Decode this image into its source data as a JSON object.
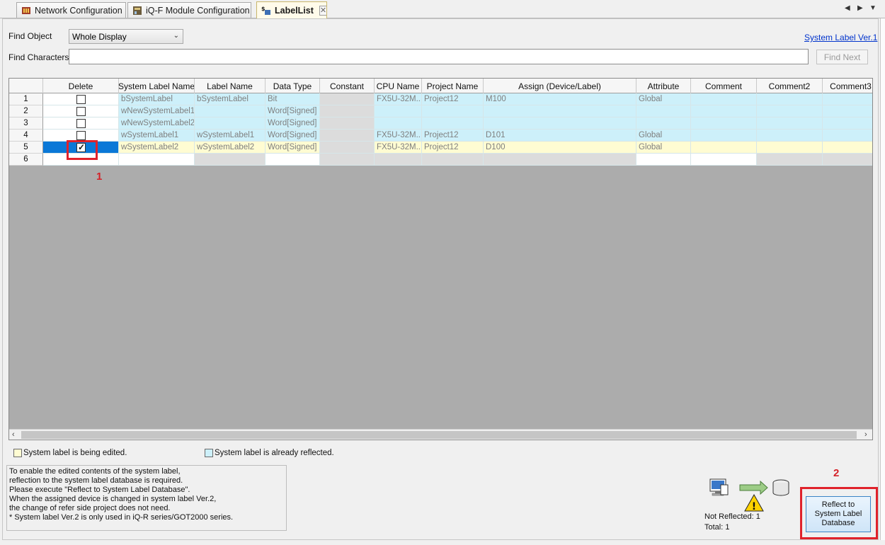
{
  "tabs": [
    {
      "label": "Network Configuration",
      "icon": "network-icon"
    },
    {
      "label": "iQ-F Module Configuration",
      "icon": "module-config-icon"
    },
    {
      "label": "LabelList",
      "icon": "label-list-icon",
      "active": true
    }
  ],
  "find": {
    "object_label": "Find Object",
    "object_value": "Whole Display",
    "characters_label": "Find Characters",
    "characters_value": "",
    "find_next": "Find Next",
    "system_label_link": "System Label Ver.1"
  },
  "table": {
    "columns": [
      "Delete",
      "System Label Name",
      "Label Name",
      "Data Type",
      "Constant",
      "CPU Name",
      "Project Name",
      "Assign (Device/Label)",
      "Attribute",
      "Comment",
      "Comment2",
      "Comment3"
    ],
    "rows": [
      {
        "num": "1",
        "delete": false,
        "system_label_name": "bSystemLabel",
        "label_name": "bSystemLabel",
        "data_type": "Bit",
        "constant": "",
        "cpu_name": "FX5U-32M...",
        "project_name": "Project12",
        "assign": "M100",
        "attribute": "Global",
        "comment": "",
        "comment2": "",
        "comment3": ""
      },
      {
        "num": "2",
        "delete": false,
        "system_label_name": "wNewSystemLabel1",
        "label_name": "",
        "data_type": "Word[Signed]",
        "constant": "",
        "cpu_name": "",
        "project_name": "",
        "assign": "",
        "attribute": "",
        "comment": "",
        "comment2": "",
        "comment3": ""
      },
      {
        "num": "3",
        "delete": false,
        "system_label_name": "wNewSystemLabel2",
        "label_name": "",
        "data_type": "Word[Signed]",
        "constant": "",
        "cpu_name": "",
        "project_name": "",
        "assign": "",
        "attribute": "",
        "comment": "",
        "comment2": "",
        "comment3": ""
      },
      {
        "num": "4",
        "delete": false,
        "system_label_name": "wSystemLabel1",
        "label_name": "wSystemLabel1",
        "data_type": "Word[Signed]",
        "constant": "",
        "cpu_name": "FX5U-32M...",
        "project_name": "Project12",
        "assign": "D101",
        "attribute": "Global",
        "comment": "",
        "comment2": "",
        "comment3": ""
      },
      {
        "num": "5",
        "delete": true,
        "system_label_name": "wSystemLabel2",
        "label_name": "wSystemLabel2",
        "data_type": "Word[Signed]",
        "constant": "",
        "cpu_name": "FX5U-32M...",
        "project_name": "Project12",
        "assign": "D100",
        "attribute": "Global",
        "comment": "",
        "comment2": "",
        "comment3": ""
      },
      {
        "num": "6"
      }
    ]
  },
  "legend": {
    "editing": "System label is being edited.",
    "reflected": "System label is already reflected."
  },
  "note_lines": [
    "To enable the edited contents of the system label,",
    "reflection to the system label database is required.",
    "Please execute \"Reflect to System Label Database\".",
    "When the assigned device is changed in system label Ver.2,",
    "the change of refer side project does not need.",
    "* System label Ver.2 is only used in iQ-R series/GOT2000 series."
  ],
  "status": {
    "not_reflected": "Not Reflected: 1",
    "total": "Total: 1"
  },
  "reflect_button": [
    "Reflect to",
    "System Label",
    "Database"
  ],
  "annotations": [
    "1",
    "2"
  ],
  "colors": {
    "reflected_row": "#cdf0fa",
    "edited_row": "#fffcd2",
    "selected": "#0a78d7",
    "annotation": "#e0222b"
  }
}
